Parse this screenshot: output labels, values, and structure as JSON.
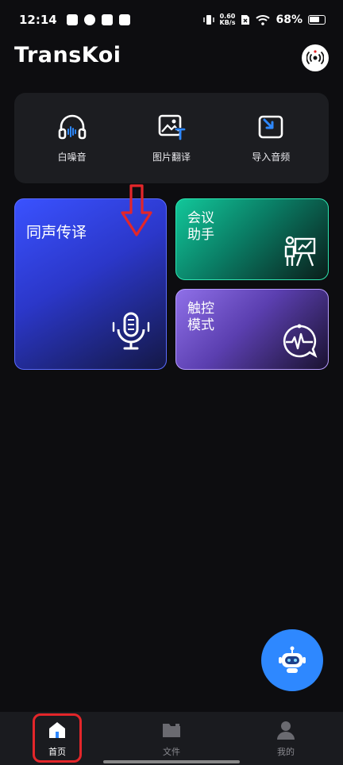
{
  "status_bar": {
    "time": "12:14",
    "net_speed_value": "0.60",
    "net_speed_unit": "KB/s",
    "battery": "68%"
  },
  "header": {
    "logo_text": "TransKoi"
  },
  "tools": [
    {
      "label": "白噪音",
      "icon": "headphones-icon"
    },
    {
      "label": "图片翻译",
      "icon": "image-translate-icon"
    },
    {
      "label": "导入音频",
      "icon": "import-audio-icon"
    }
  ],
  "cards": {
    "simultaneous": {
      "title": "同声传译",
      "icon": "microphone-icon"
    },
    "meeting": {
      "title_line1": "会议",
      "title_line2": "助手",
      "icon": "presentation-icon"
    },
    "touch": {
      "title_line1": "触控",
      "title_line2": "模式",
      "icon": "waveform-chat-icon"
    }
  },
  "bottom_nav": [
    {
      "label": "首页",
      "icon": "home-icon",
      "active": true
    },
    {
      "label": "文件",
      "icon": "folder-icon",
      "active": false
    },
    {
      "label": "我的",
      "icon": "user-icon",
      "active": false
    }
  ],
  "colors": {
    "background": "#0d0d10",
    "accent_blue": "#2e88ff",
    "annotation_red": "#e3262a"
  }
}
